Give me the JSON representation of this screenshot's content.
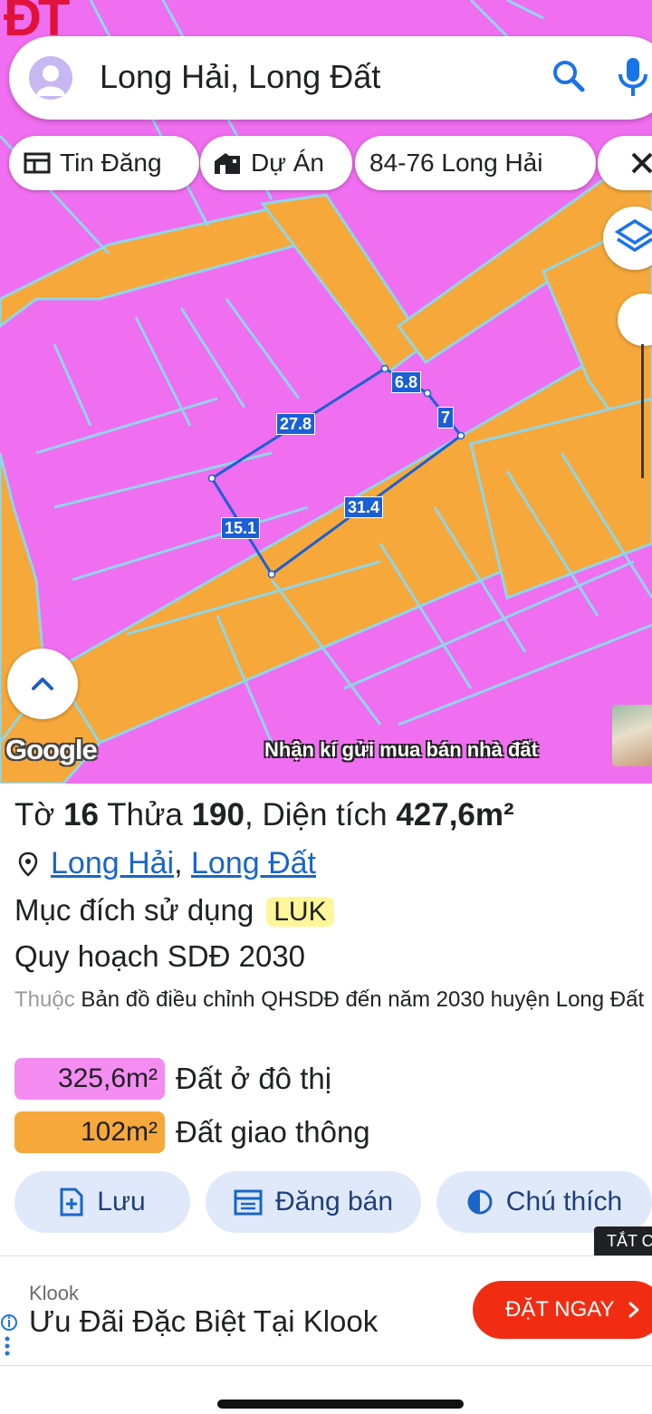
{
  "map": {
    "corner_mark": "ĐT",
    "google_logo": "Google",
    "watermark": "Nhận kí gửi mua bán nhà đất",
    "segment_labels": [
      "6.8",
      "7",
      "27.8",
      "31.4",
      "15.1"
    ],
    "colors": {
      "residential": "#f06ef0",
      "road": "#f6a83a",
      "parcel_outline": "#1a5fd6",
      "boundary": "#8fd6e8"
    }
  },
  "search": {
    "text": "Long Hải, Long Đất",
    "icons": [
      "avatar-icon",
      "search-icon",
      "mic-icon"
    ]
  },
  "chips": [
    {
      "label": "Tin Đăng",
      "icon": "list-icon"
    },
    {
      "label": "Dự Án",
      "icon": "building-icon"
    },
    {
      "label": "84-76 Long Hải",
      "icon": ""
    }
  ],
  "parcel": {
    "to_label": "Tờ",
    "to": "16",
    "thua_label": "Thửa",
    "thua": "190",
    "area_label": "Diện tích",
    "area": "427,6m²",
    "location_1": "Long Hải",
    "location_sep": ",",
    "location_2": "Long Đất",
    "purpose_label": "Mục đích sử dụng",
    "purpose_code": "LUK",
    "planning_title": "Quy hoạch SDĐ 2030",
    "belongs_label": "Thuộc",
    "belongs_text": "Bản đồ điều chỉnh QHSDĐ đến năm 2030 huyện Long Đất",
    "zones": [
      {
        "area": "325,6m²",
        "name": "Đất ở đô thị",
        "color": "#f48cf2"
      },
      {
        "area": "102m²",
        "name": "Đất giao thông",
        "color": "#f6a83a"
      }
    ]
  },
  "actions": {
    "save": "Lưu",
    "post": "Đăng bán",
    "legend": "Chú thích",
    "tat": "TẮT C"
  },
  "ad": {
    "brand": "Klook",
    "title": "Ưu Đãi Đặc Biệt Tại Klook",
    "cta": "ĐẶT NGAY",
    "cta_color": "#f02d12"
  }
}
